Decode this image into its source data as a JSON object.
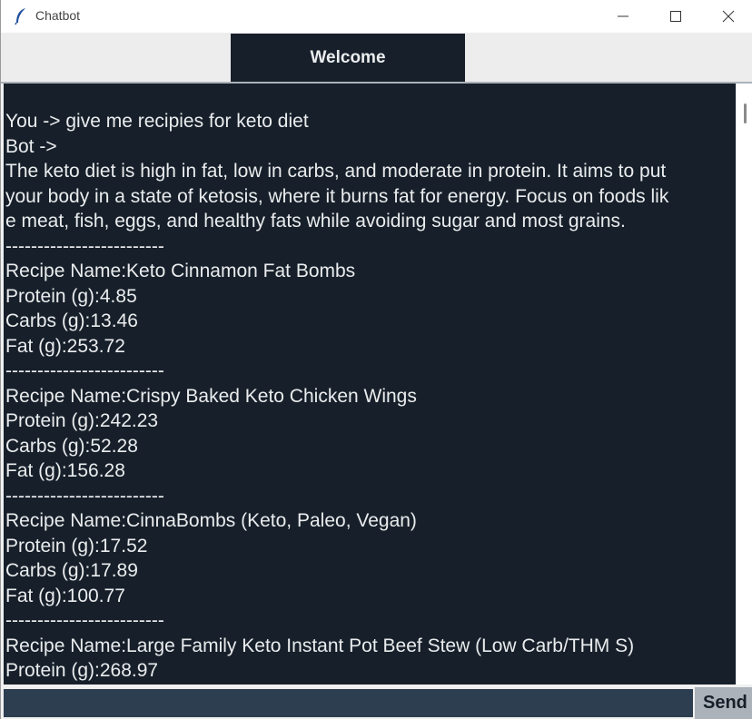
{
  "window": {
    "title": "Chatbot",
    "icon": "feather-icon"
  },
  "header": {
    "label": "Welcome"
  },
  "chat": {
    "lines": [
      "You -> give me recipies for keto diet",
      "Bot ->",
      "The keto diet is high in fat, low in carbs, and moderate in protein. It aims to put",
      "your body in a state of ketosis, where it burns fat for energy. Focus on foods lik",
      "e meat, fish, eggs, and healthy fats while avoiding sugar and most grains.",
      "-------------------------",
      "Recipe Name:Keto Cinnamon Fat Bombs",
      "Protein (g):4.85",
      "Carbs (g):13.46",
      "Fat (g):253.72",
      "-------------------------",
      "Recipe Name:Crispy Baked Keto Chicken Wings",
      "Protein (g):242.23",
      "Carbs (g):52.28",
      "Fat (g):156.28",
      "-------------------------",
      "Recipe Name:CinnaBombs (Keto, Paleo, Vegan)",
      "Protein (g):17.52",
      "Carbs (g):17.89",
      "Fat (g):100.77",
      "-------------------------",
      "Recipe Name:Large Family Keto Instant Pot Beef Stew (Low Carb/THM S)",
      "Protein (g):268.97"
    ]
  },
  "input": {
    "value": "",
    "send_label": "Send"
  },
  "colors": {
    "chat_bg": "#17202A",
    "text": "#EAECEE",
    "entry_bg": "#2C3E50",
    "button_bg": "#ABB2B9"
  }
}
